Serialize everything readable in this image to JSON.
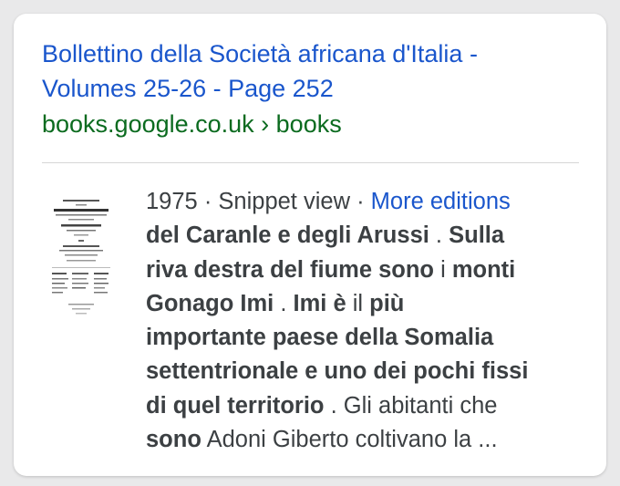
{
  "result": {
    "title": "Bollettino della Società africana d'Italia - Volumes 25-26 - Page 252",
    "cite": "books.google.co.uk › books"
  },
  "meta": {
    "year": "1975",
    "separator": " · ",
    "view_type": "Snippet view",
    "more_editions": "More editions"
  },
  "snippet": {
    "lines": [
      [
        {
          "t": "del Caranle e degli Arussi",
          "b": true
        },
        {
          "t": " . ",
          "b": false
        },
        {
          "t": "Sulla",
          "b": true
        }
      ],
      [
        {
          "t": "riva destra del fiume sono",
          "b": true
        },
        {
          "t": " i ",
          "b": false
        },
        {
          "t": "monti",
          "b": true
        }
      ],
      [
        {
          "t": "Gonago Imi",
          "b": true
        },
        {
          "t": " . ",
          "b": false
        },
        {
          "t": "Imi è",
          "b": true
        },
        {
          "t": " il ",
          "b": false
        },
        {
          "t": "più",
          "b": true
        }
      ],
      [
        {
          "t": "importante paese della Somalia",
          "b": true
        }
      ],
      [
        {
          "t": "settentrionale e uno dei pochi fissi",
          "b": true
        }
      ],
      [
        {
          "t": "di quel territorio",
          "b": true
        },
        {
          "t": " . Gli abitanti che",
          "b": false
        }
      ],
      [
        {
          "t": "sono",
          "b": true
        },
        {
          "t": " Adoni Giberto coltivano la ...",
          "b": false
        }
      ]
    ]
  },
  "thumbnail": {
    "icon": "book-cover-thumbnail",
    "text": "BOLLETTINO SOCIETÀ AFRICANA D'ITALIA"
  },
  "colors": {
    "link": "#1a56cc",
    "cite": "#0b6b1f",
    "text": "#3c4043",
    "background": "#e9e9ea",
    "card": "#ffffff"
  }
}
